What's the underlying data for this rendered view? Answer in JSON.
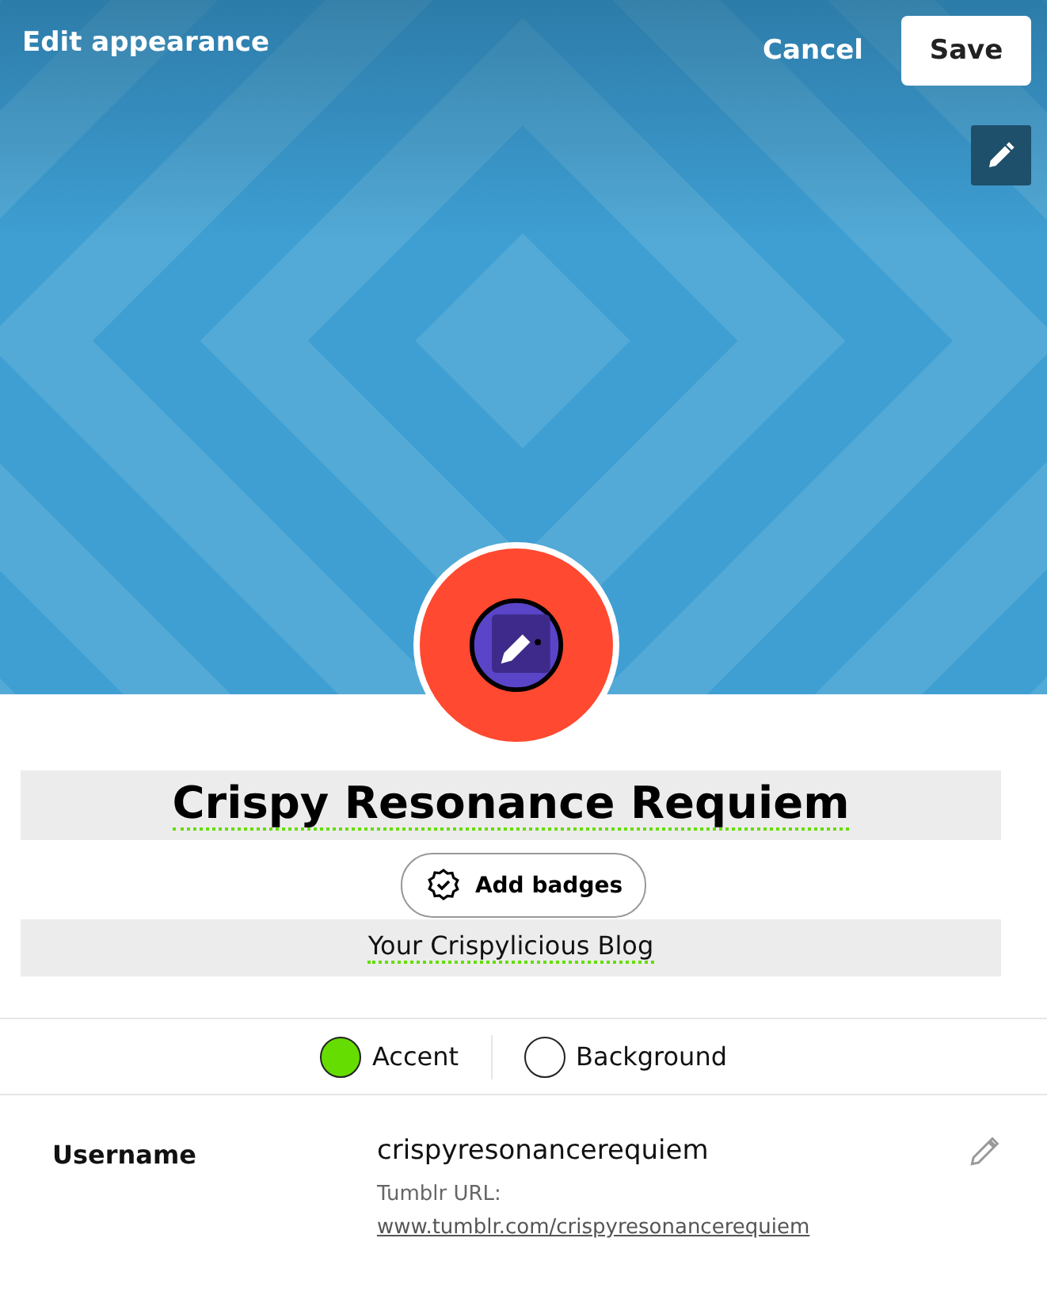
{
  "header": {
    "title": "Edit appearance",
    "cancel": "Cancel",
    "save": "Save"
  },
  "blog": {
    "title": "Crispy Resonance Requiem",
    "badges_button": "Add badges",
    "description": "Your Crispylicious Blog"
  },
  "colors": [
    {
      "label": "Accent",
      "color": "#66dd00"
    },
    {
      "label": "Background",
      "color": "#ffffff"
    }
  ],
  "username": {
    "label": "Username",
    "value": "crispyresonancerequiem",
    "url_label": "Tumblr URL:",
    "url": "www.tumblr.com/crispyresonancerequiem"
  }
}
